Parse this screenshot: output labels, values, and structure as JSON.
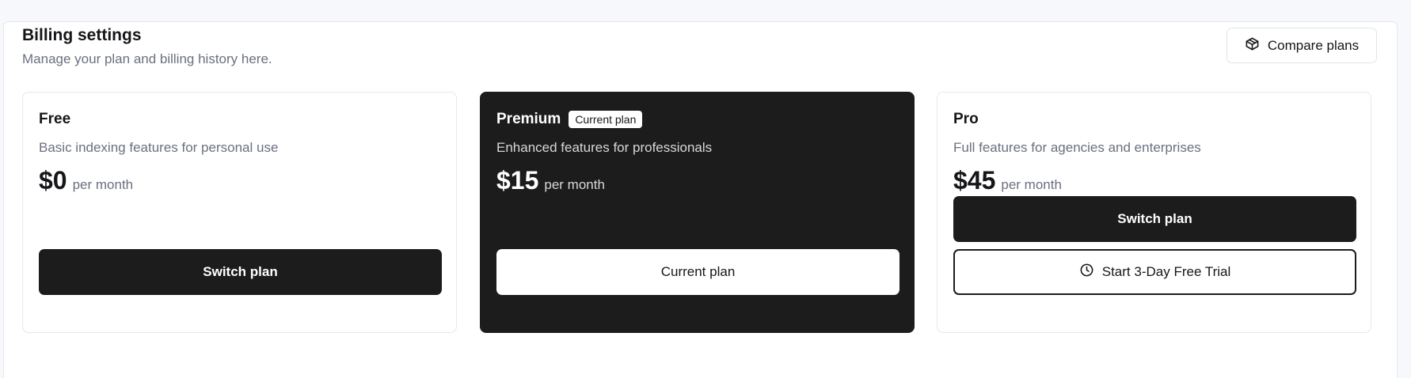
{
  "header": {
    "title": "Billing settings",
    "subtitle": "Manage your plan and billing history here.",
    "compare_label": "Compare plans",
    "compare_icon": "box-icon"
  },
  "plans": [
    {
      "name": "Free",
      "description": "Basic indexing features for personal use",
      "price": "$0",
      "period": "per month",
      "primary_action": "Switch plan"
    },
    {
      "name": "Premium",
      "badge": "Current plan",
      "description": "Enhanced features for professionals",
      "price": "$15",
      "period": "per month",
      "primary_action": "Current plan"
    },
    {
      "name": "Pro",
      "description": "Full features for agencies and enterprises",
      "price": "$45",
      "period": "per month",
      "primary_action": "Switch plan",
      "secondary_action": "Start 3-Day Free Trial",
      "secondary_icon": "clock-icon"
    }
  ],
  "colors": {
    "dark": "#1c1c1c",
    "muted_text": "#6b7080",
    "page_bg": "#f7f8fb"
  }
}
